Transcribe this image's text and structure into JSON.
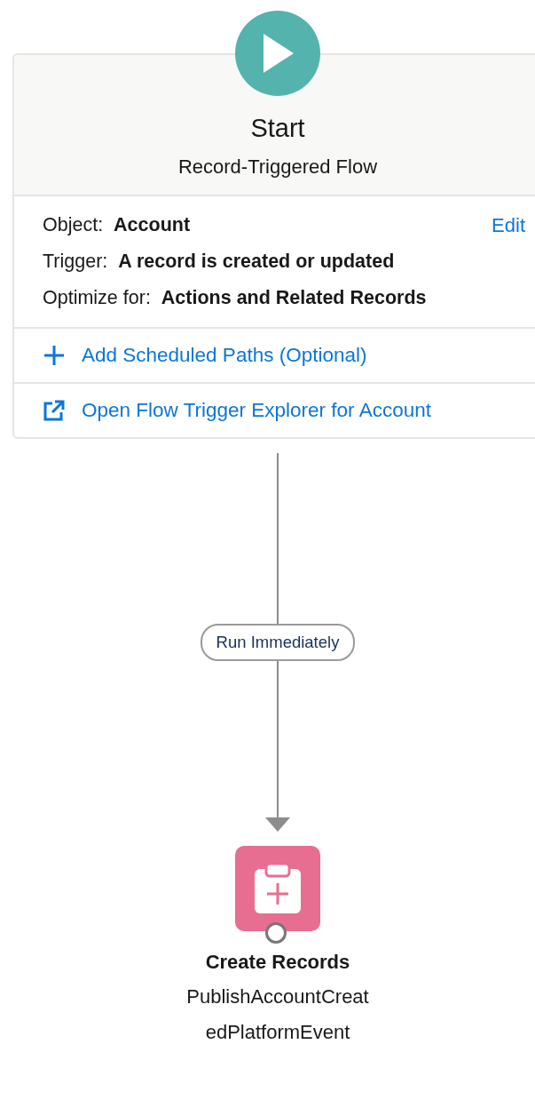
{
  "start": {
    "title": "Start",
    "subtitle": "Record-Triggered Flow",
    "fields": [
      {
        "label": "Object:",
        "value": "Account"
      },
      {
        "label": "Trigger:",
        "value": "A record is created or updated"
      },
      {
        "label": "Optimize for:",
        "value": "Actions and Related Records"
      }
    ],
    "edit_link": "Edit",
    "actions": [
      {
        "kind": "add",
        "label": "Add Scheduled Paths (Optional)"
      },
      {
        "kind": "external",
        "label": "Open Flow Trigger Explorer for Account"
      }
    ]
  },
  "connector": {
    "label": "Run Immediately"
  },
  "element": {
    "type": "Create Records",
    "label": "PublishAccountCreatedPlatformEvent"
  }
}
